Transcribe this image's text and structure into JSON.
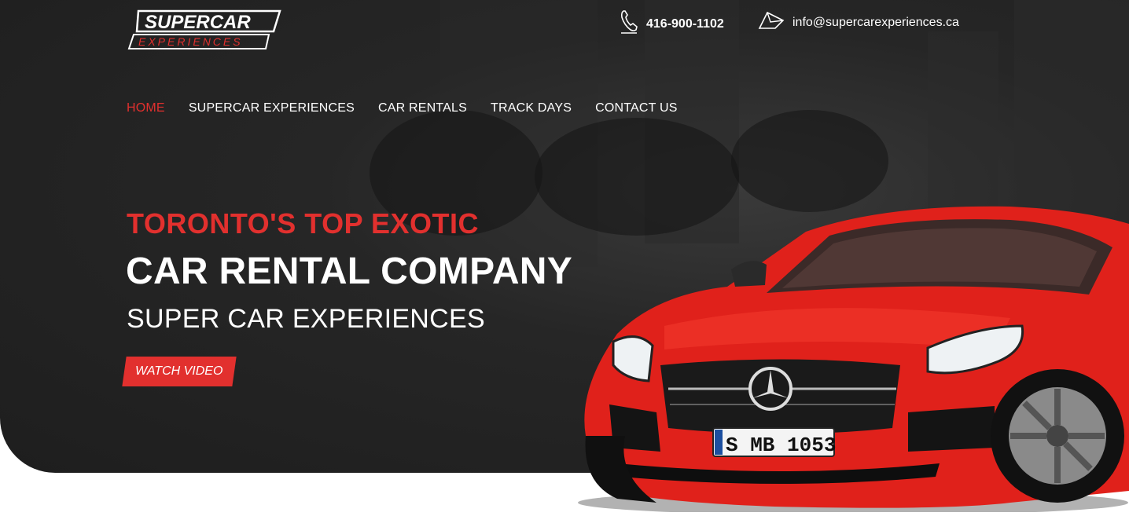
{
  "brand": {
    "logo_top": "SUPERCAR",
    "logo_bottom": "EXPERIENCES"
  },
  "header": {
    "phone": "416-900-1102",
    "phone_icon": "phone-icon",
    "email": "info@supercarexperiences.ca",
    "email_icon": "email-icon"
  },
  "nav": {
    "items": [
      {
        "label": "HOME",
        "active": true
      },
      {
        "label": "SUPERCAR EXPERIENCES",
        "active": false
      },
      {
        "label": "CAR RENTALS",
        "active": false
      },
      {
        "label": "TRACK DAYS",
        "active": false
      },
      {
        "label": "CONTACT US",
        "active": false
      }
    ]
  },
  "hero": {
    "line1": "TORONTO'S TOP EXOTIC",
    "line2": "CAR RENTAL COMPANY",
    "line3": "SUPER CAR EXPERIENCES",
    "cta_label": "WATCH VIDEO"
  },
  "car": {
    "plate": "S MB 1053"
  },
  "colors": {
    "accent": "#e2302e",
    "hero_bg": "#232323",
    "text": "#ffffff"
  }
}
